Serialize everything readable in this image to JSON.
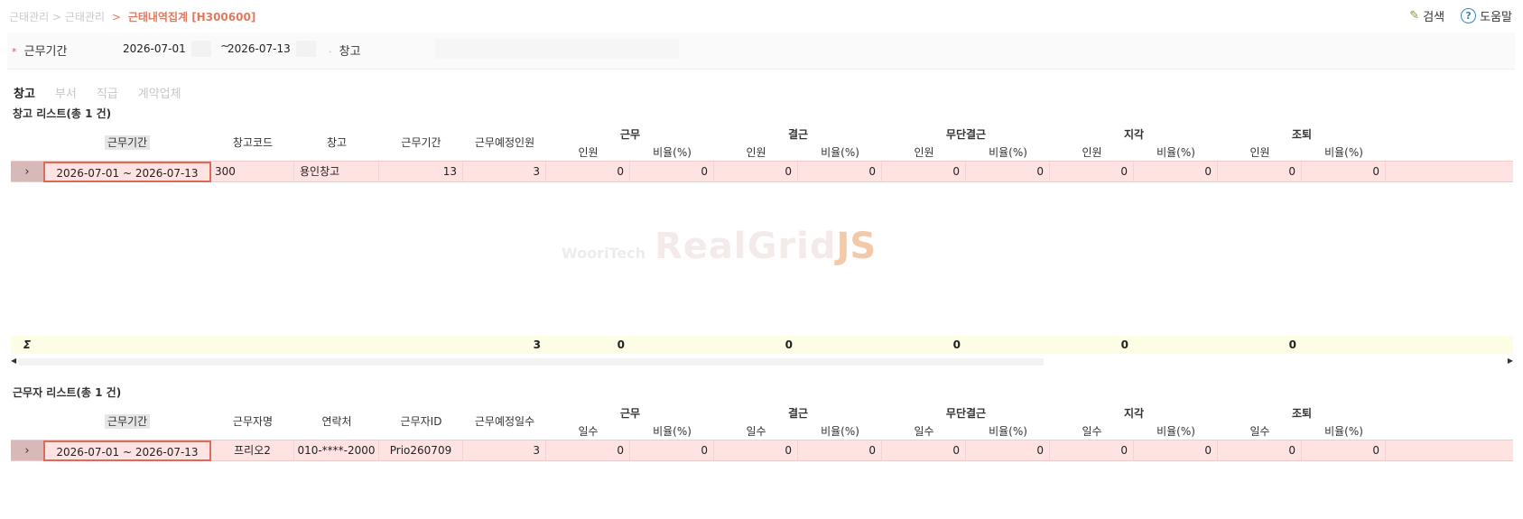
{
  "breadcrumb": {
    "part1": "근태관리",
    "part2": "근태관리",
    "current": "근태내역집계 [H300600]"
  },
  "top_buttons": {
    "search": "검색",
    "help": "도움말"
  },
  "search": {
    "period_label": "근무기간",
    "date_from": "2026-07-01",
    "date_sep": "~",
    "date_to": "2026-07-13",
    "warehouse_label": "창고"
  },
  "tabs": [
    "창고",
    "부서",
    "직급",
    "계약업체"
  ],
  "grid1": {
    "title": "창고 리스트(총 1 건)",
    "columns": {
      "period": "근무기간",
      "code": "창고코드",
      "name": "창고",
      "days": "근무기간",
      "planned": "근무예정인원"
    },
    "groups": [
      "근무",
      "결근",
      "무단결근",
      "지각",
      "조퇴"
    ],
    "sub": {
      "count": "인원",
      "ratio": "비율(%)"
    },
    "row": {
      "period": "2026-07-01 ~ 2026-07-13",
      "code": "300",
      "name": "용인창고",
      "days": "13",
      "planned": "3",
      "values": [
        "0",
        "0",
        "0",
        "0",
        "0",
        "0",
        "0",
        "0",
        "0",
        "0"
      ]
    },
    "summary": {
      "sigma": "Σ",
      "planned": "3",
      "values": [
        "0",
        "0",
        "0",
        "0",
        "0"
      ]
    }
  },
  "grid2": {
    "title": "근무자 리스트(총 1 건)",
    "columns": {
      "period": "근무기간",
      "worker": "근무자명",
      "phone": "연락처",
      "worker_id": "근무자ID",
      "planned": "근무예정일수"
    },
    "groups": [
      "근무",
      "결근",
      "무단결근",
      "지각",
      "조퇴"
    ],
    "sub": {
      "count": "일수",
      "ratio": "비율(%)"
    },
    "row": {
      "period": "2026-07-01 ~ 2026-07-13",
      "worker": "프리오2",
      "phone": "010-****-2000",
      "worker_id": "Prio260709",
      "planned": "3",
      "values": [
        "0",
        "0",
        "0",
        "0",
        "0",
        "0",
        "0",
        "0",
        "0",
        "0"
      ]
    }
  },
  "watermark": {
    "small": "WooriTech",
    "big": "RealGrid",
    "js": "JS"
  },
  "colors": {
    "accent": "#e07a5f",
    "row_bg": "#ffe3e3",
    "summary_bg": "#fdfde6"
  }
}
